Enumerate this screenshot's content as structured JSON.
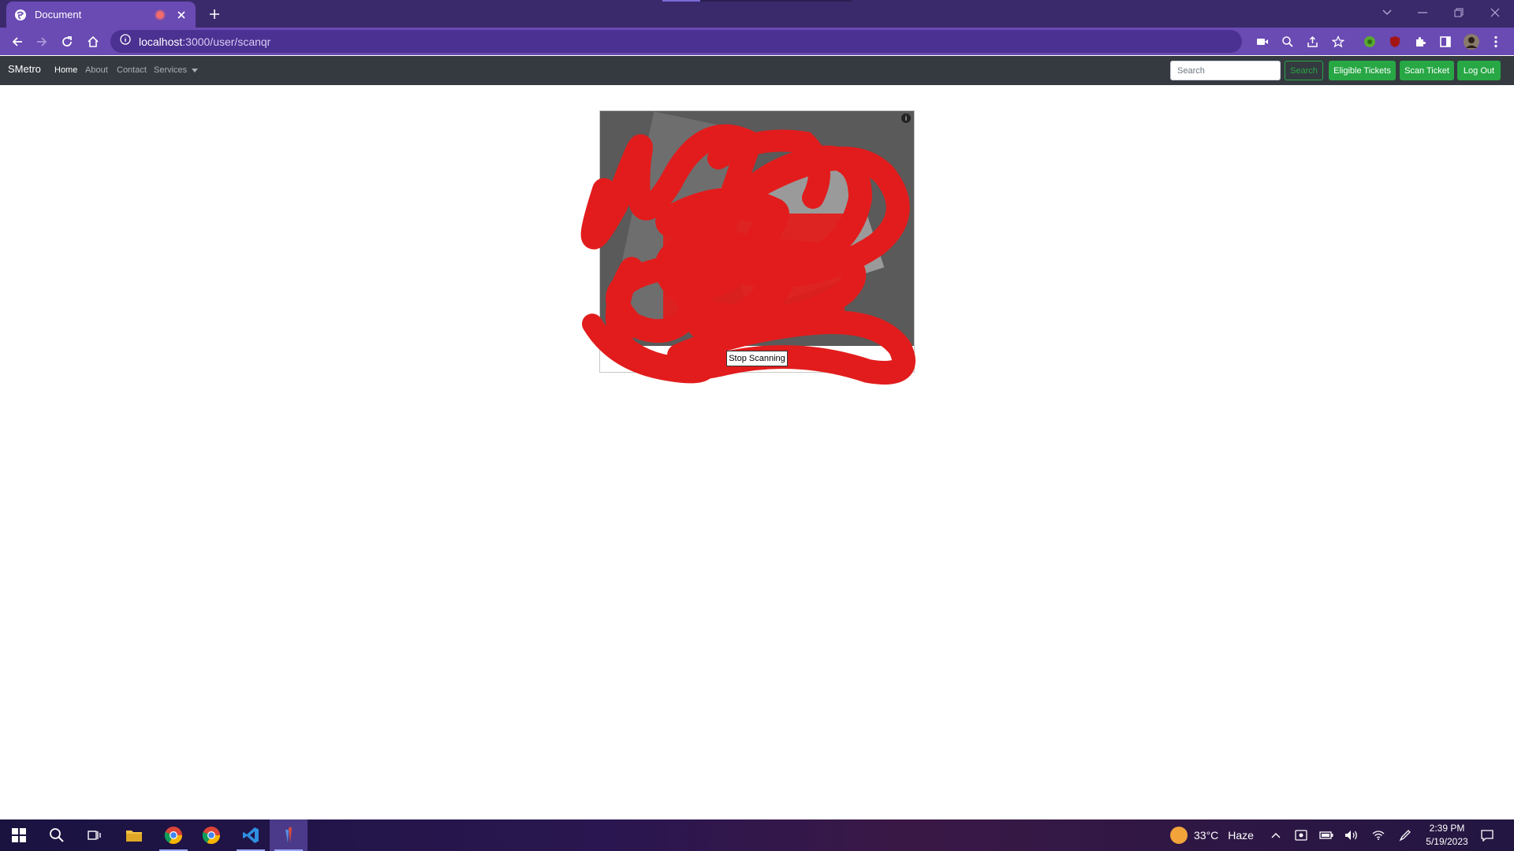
{
  "browser": {
    "tab_title": "Document",
    "url_host": "localhost",
    "url_path": ":3000/user/scanqr"
  },
  "navbar": {
    "brand": "SMetro",
    "links": [
      "Home",
      "About",
      "Contact",
      "Services"
    ],
    "active_link": "Home",
    "search_placeholder": "Search",
    "search_button": "Search",
    "buttons": [
      "Eligible Tickets",
      "Scan Ticket",
      "Log Out"
    ]
  },
  "scanner": {
    "stop_button": "Stop Scanning",
    "info_icon": "i"
  },
  "taskbar": {
    "weather_temp": "33°C",
    "weather_desc": "Haze",
    "time": "2:39 PM",
    "date": "5/19/2023"
  },
  "colors": {
    "tab_bar": "#3b2a6b",
    "toolbar": "#6a4ab3",
    "navbar": "#343a40",
    "button_green": "#28a745",
    "scribble_red": "#e21c1c"
  }
}
